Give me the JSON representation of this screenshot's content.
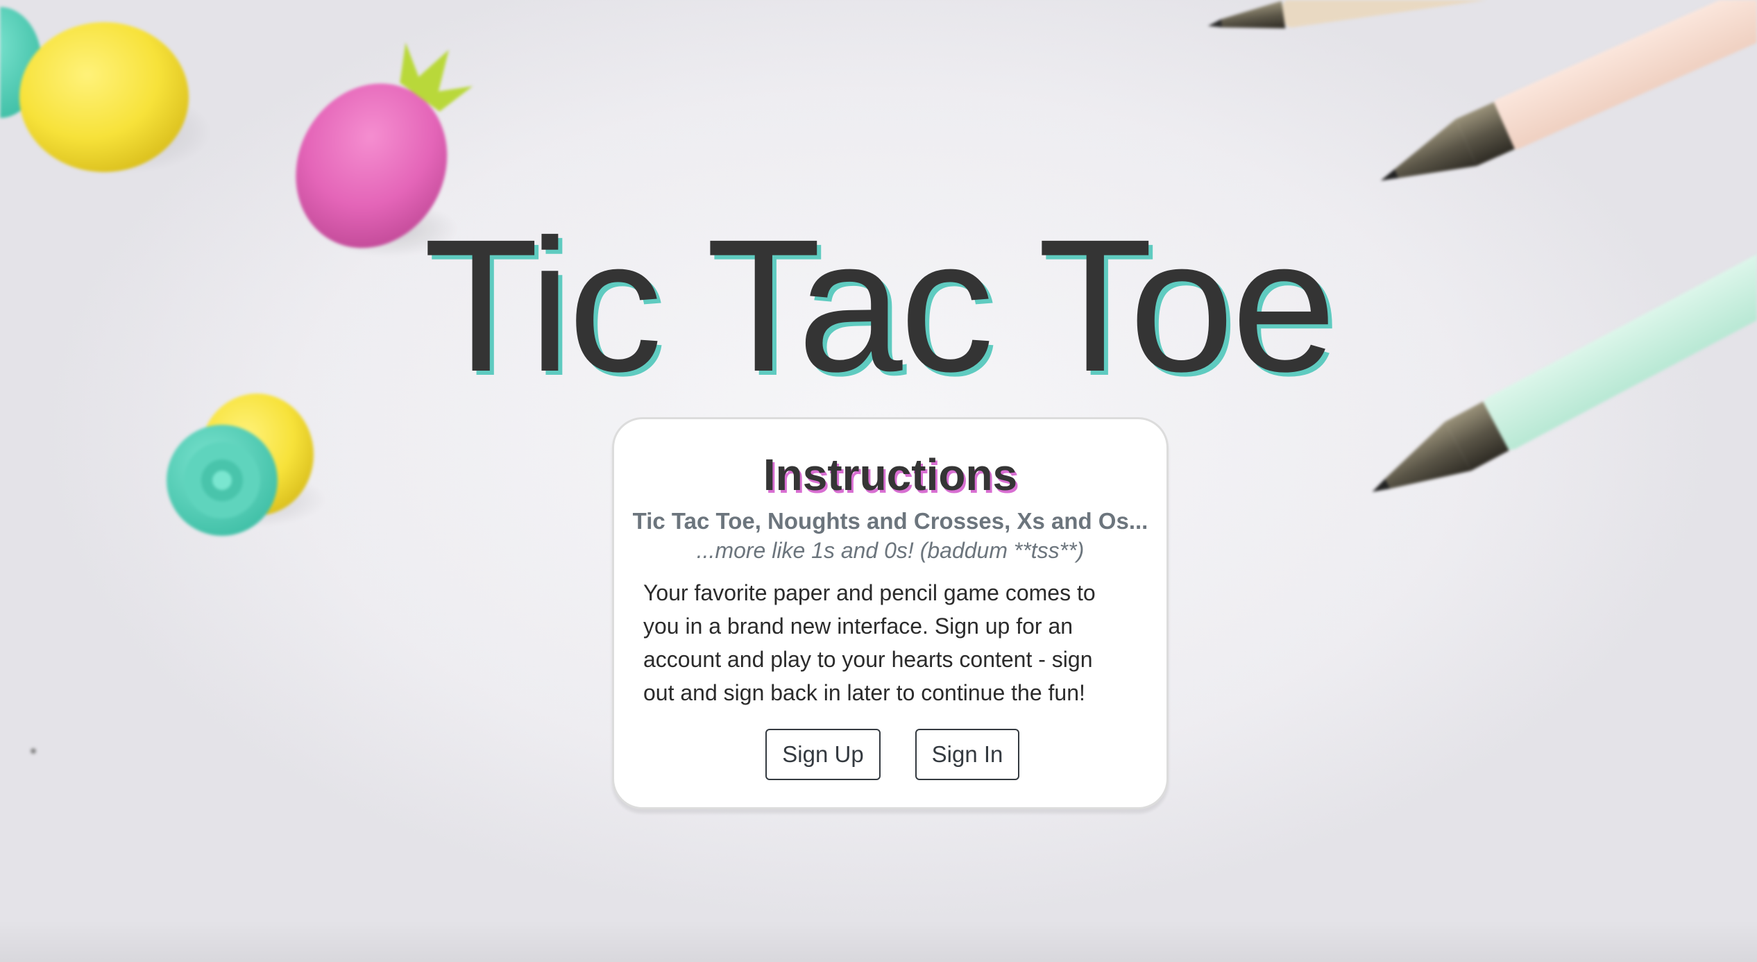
{
  "page": {
    "title": "Tic Tac Toe"
  },
  "card": {
    "heading": "Instructions",
    "subtitle": "Tic Tac Toe, Noughts and Crosses, Xs and Os...",
    "subtitle_italic": "...more like 1s and 0s! (baddum **tss**)",
    "body": "Your favorite paper and pencil game comes to you in a brand new interface. Sign up for an account and play to your hearts content - sign out and sign back in later to continue the fun!",
    "buttons": {
      "sign_up": "Sign Up",
      "sign_in": "Sign In"
    }
  },
  "colors": {
    "title_shadow": "#5fcbc0",
    "heading_shadow": "#d86fd2",
    "text_dark": "#343434",
    "muted": "#6c757d"
  },
  "background": {
    "description_icons": [
      "pineapple-eraser-icon",
      "pen-icon"
    ]
  }
}
